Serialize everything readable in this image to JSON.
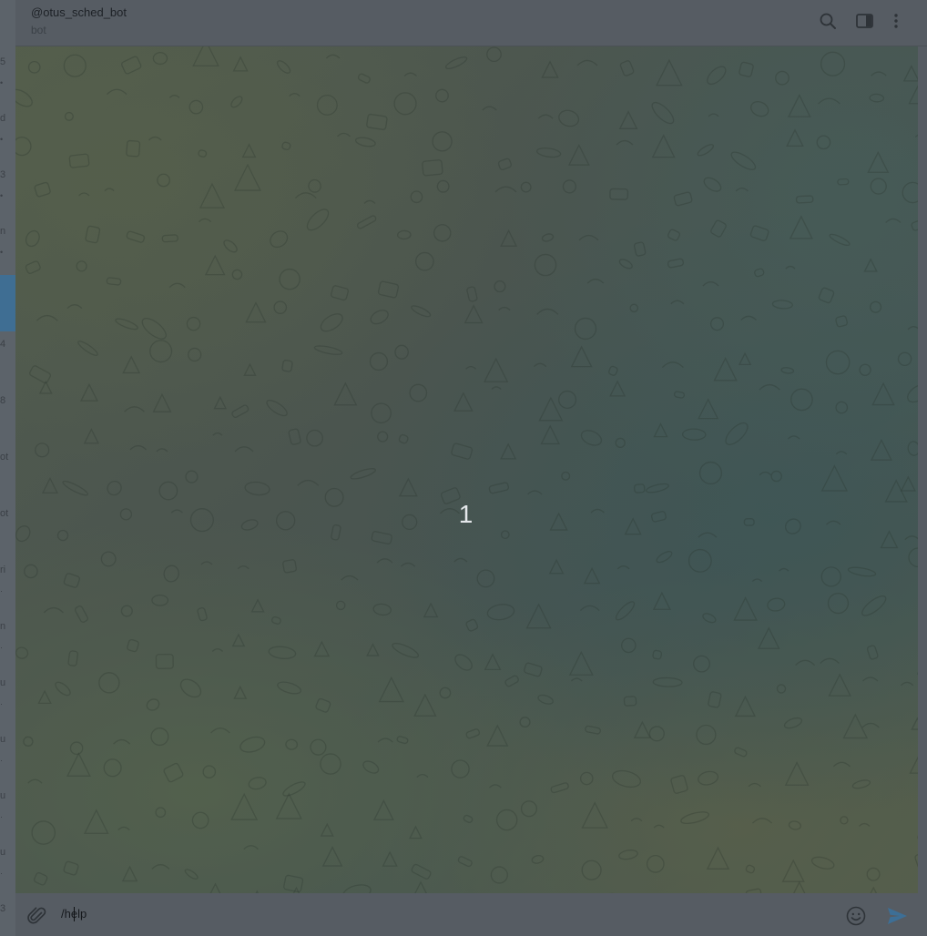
{
  "header": {
    "title": "@otus_sched_bot",
    "subtitle": "bot",
    "search_icon": "search-icon",
    "sidebar_toggle_icon": "sidebar-toggle-icon",
    "more_icon": "more-vertical-icon"
  },
  "chat_list_strip": {
    "rows": [
      {
        "char": "5",
        "mark": "•"
      },
      {
        "char": "d",
        "mark": "•"
      },
      {
        "char": "3",
        "mark": "•"
      },
      {
        "char": "n",
        "mark": "•"
      },
      {
        "char": "",
        "mark": ""
      },
      {
        "char": "4",
        "mark": ""
      },
      {
        "char": "8",
        "mark": ""
      },
      {
        "char": "ot",
        "mark": ""
      },
      {
        "char": "ot",
        "mark": ""
      },
      {
        "char": "ri",
        "mark": "·"
      },
      {
        "char": "n",
        "mark": "·"
      },
      {
        "char": "u",
        "mark": "·"
      },
      {
        "char": "u",
        "mark": "·"
      },
      {
        "char": "u",
        "mark": "·"
      },
      {
        "char": "u",
        "mark": "·"
      },
      {
        "char": "3",
        "mark": ""
      }
    ],
    "active_index": 4
  },
  "chat": {
    "center_text": "1"
  },
  "composer": {
    "input_value": "/help",
    "attach_icon": "paperclip-icon",
    "emoji_icon": "emoji-icon",
    "send_icon": "send-icon"
  },
  "colors": {
    "overlay_gray": "#565c63",
    "active_chat": "#3f6e93",
    "send_accent": "#3d6f96"
  }
}
